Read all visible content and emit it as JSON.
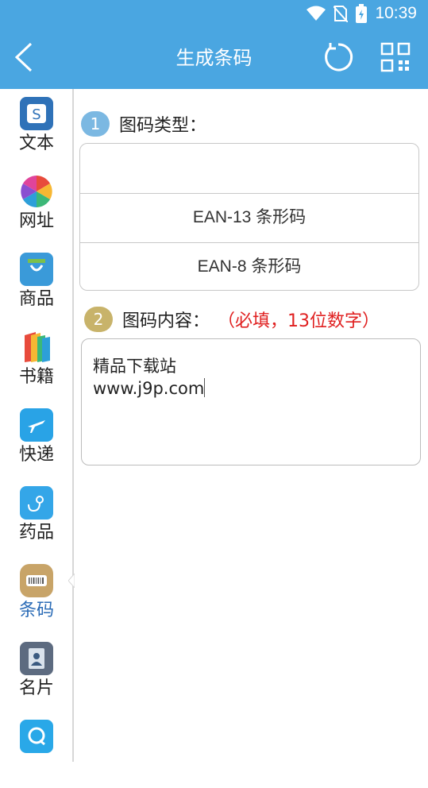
{
  "status": {
    "time": "10:39"
  },
  "appbar": {
    "title": "生成条码",
    "back_icon": "chevron-left-icon",
    "reset_icon": "refresh-icon",
    "qr_icon": "qr-code-icon"
  },
  "sidebar": {
    "items": [
      {
        "label": "文本",
        "icon": "text-icon"
      },
      {
        "label": "网址",
        "icon": "url-icon"
      },
      {
        "label": "商品",
        "icon": "product-icon"
      },
      {
        "label": "书籍",
        "icon": "book-icon"
      },
      {
        "label": "快递",
        "icon": "express-icon"
      },
      {
        "label": "药品",
        "icon": "medicine-icon"
      },
      {
        "label": "条码",
        "icon": "barcode-icon",
        "active": true
      },
      {
        "label": "名片",
        "icon": "contact-card-icon"
      }
    ]
  },
  "form": {
    "step1": {
      "number": "1",
      "label": "图码类型："
    },
    "types": [
      "",
      "EAN-13 条形码",
      "EAN-8 条形码"
    ],
    "step2": {
      "number": "2",
      "label": "图码内容：",
      "required_note": "（必填，13位数字）"
    },
    "content_value_line1": "精品下载站",
    "content_value_line2": "www.j9p.com"
  },
  "colors": {
    "accent": "#4aa6e1",
    "active": "#2a6bb6",
    "required": "#e02020"
  }
}
